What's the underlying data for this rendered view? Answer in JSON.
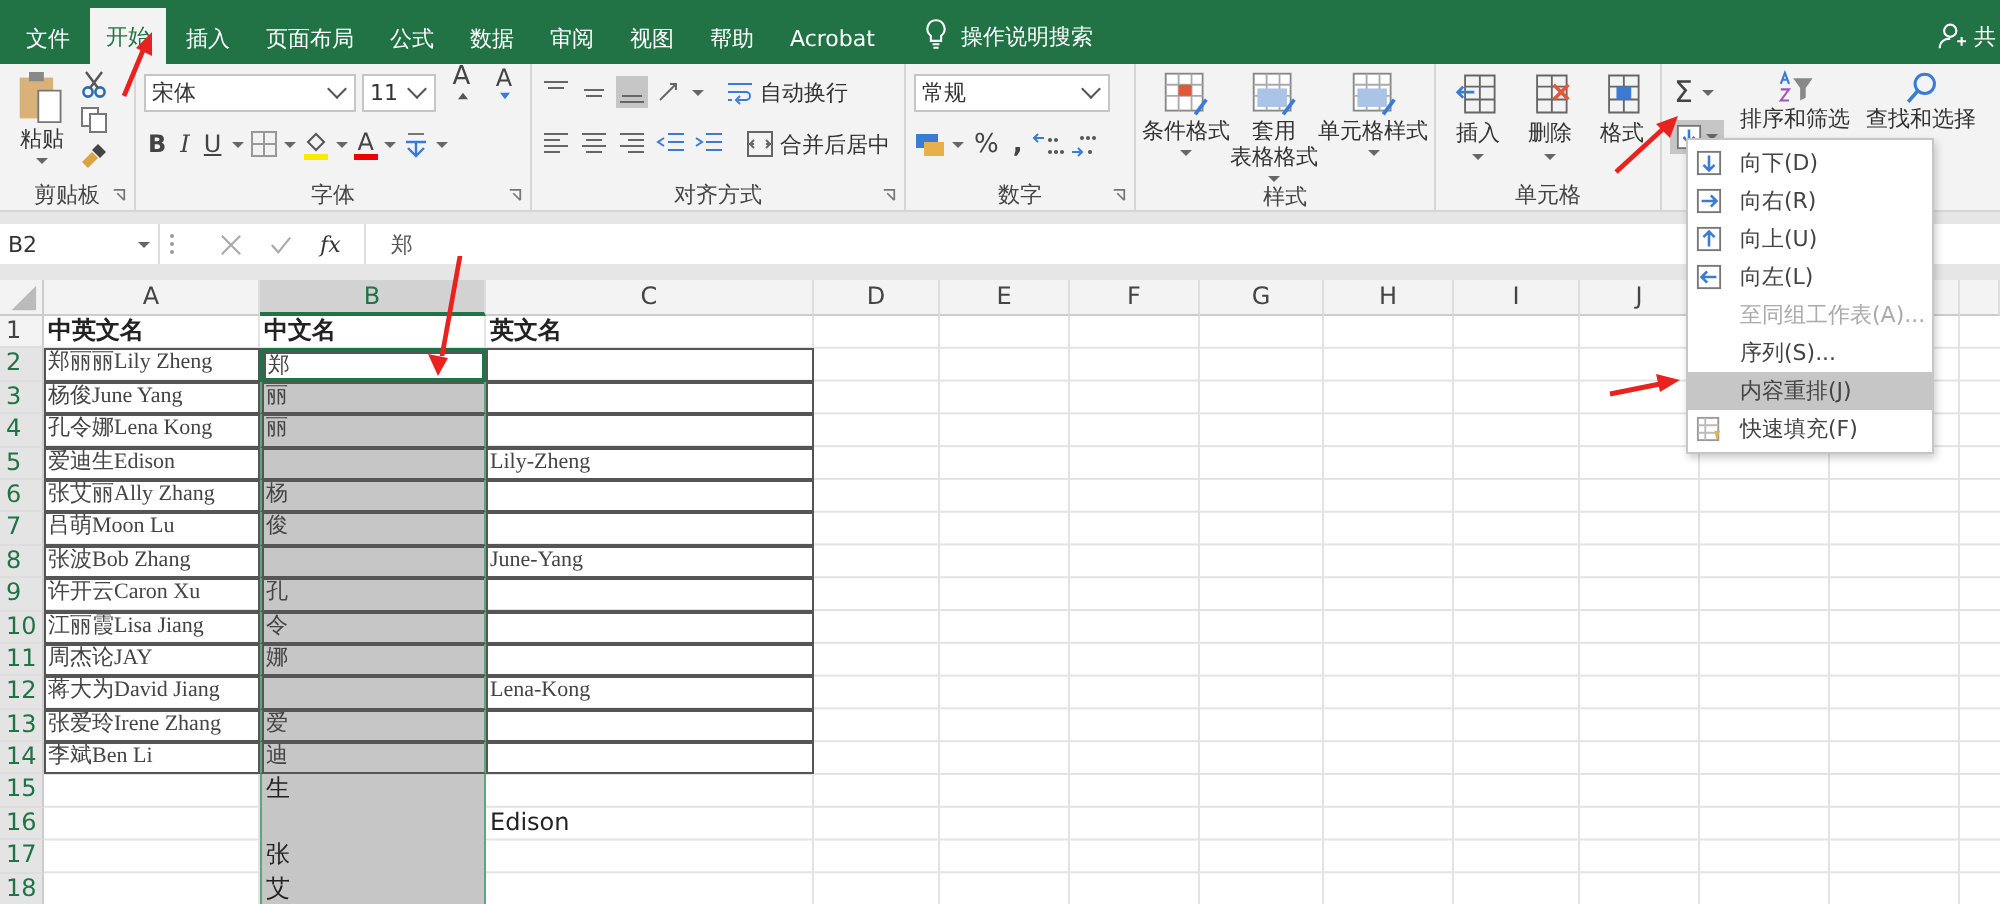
{
  "tabs": [
    {
      "label": "文件",
      "selected": false
    },
    {
      "label": "开始",
      "selected": true
    },
    {
      "label": "插入",
      "selected": false
    },
    {
      "label": "页面布局",
      "selected": false
    },
    {
      "label": "公式",
      "selected": false
    },
    {
      "label": "数据",
      "selected": false
    },
    {
      "label": "审阅",
      "selected": false
    },
    {
      "label": "视图",
      "selected": false
    },
    {
      "label": "帮助",
      "selected": false
    },
    {
      "label": "Acrobat",
      "selected": false
    }
  ],
  "tell_me": "操作说明搜索",
  "share": "共",
  "ribbon": {
    "clipboard": {
      "paste": "粘贴",
      "label": "剪贴板"
    },
    "font": {
      "name": "宋体",
      "size": "11",
      "grow": "A",
      "shrink": "A",
      "bold": "B",
      "italic": "I",
      "underline": "U",
      "color_button": "A",
      "label": "字体"
    },
    "alignment": {
      "wrap": "自动换行",
      "merge": "合并后居中",
      "label": "对齐方式"
    },
    "number": {
      "format": "常规",
      "percent": "%",
      "comma": ",",
      "label": "数字"
    },
    "styles": {
      "buttons": [
        {
          "lines": [
            "条件格式"
          ]
        },
        {
          "lines": [
            "套用",
            "表格格式"
          ]
        },
        {
          "lines": [
            "单元格样式"
          ]
        }
      ],
      "label": "样式"
    },
    "cells": {
      "buttons": [
        "插入",
        "删除",
        "格式"
      ],
      "label": "单元格"
    },
    "editing": {
      "sum": "Σ",
      "fill_open": true,
      "sort": "排序和筛选",
      "find": "查找和选择"
    }
  },
  "formula_bar": {
    "name_box": "B2",
    "fx": "fx",
    "value": "郑"
  },
  "columns": [
    {
      "label": "A",
      "selected": false
    },
    {
      "label": "B",
      "selected": true
    },
    {
      "label": "C",
      "selected": false
    },
    {
      "label": "D",
      "selected": false
    },
    {
      "label": "E",
      "selected": false
    },
    {
      "label": "F",
      "selected": false
    },
    {
      "label": "G",
      "selected": false
    },
    {
      "label": "H",
      "selected": false
    },
    {
      "label": "I",
      "selected": false
    },
    {
      "label": "J",
      "selected": false
    }
  ],
  "rows": [
    {
      "number": "1",
      "kind": "header",
      "selected": false,
      "active": false,
      "cells": {
        "A": "中英文名",
        "B": "中文名",
        "C": "英文名"
      }
    },
    {
      "number": "2",
      "kind": "table",
      "selected": true,
      "active": true,
      "cells": {
        "A": "郑丽丽Lily Zheng",
        "B": "郑"
      }
    },
    {
      "number": "3",
      "kind": "table",
      "selected": true,
      "active": false,
      "cells": {
        "A": "杨俊June Yang",
        "B": "丽"
      }
    },
    {
      "number": "4",
      "kind": "table",
      "selected": true,
      "active": false,
      "cells": {
        "A": "孔令娜Lena Kong",
        "B": "丽"
      }
    },
    {
      "number": "5",
      "kind": "table",
      "selected": true,
      "active": false,
      "cells": {
        "A": "爱迪生Edison",
        "C": "Lily-Zheng"
      }
    },
    {
      "number": "6",
      "kind": "table",
      "selected": true,
      "active": false,
      "cells": {
        "A": "张艾丽Ally Zhang",
        "B": "杨"
      }
    },
    {
      "number": "7",
      "kind": "table",
      "selected": true,
      "active": false,
      "cells": {
        "A": "吕萌Moon Lu",
        "B": "俊"
      }
    },
    {
      "number": "8",
      "kind": "table",
      "selected": true,
      "active": false,
      "cells": {
        "A": "张波Bob Zhang",
        "C": "June-Yang"
      }
    },
    {
      "number": "9",
      "kind": "table",
      "selected": true,
      "active": false,
      "cells": {
        "A": "许开云Caron Xu",
        "B": "孔"
      }
    },
    {
      "number": "10",
      "kind": "table",
      "selected": true,
      "active": false,
      "cells": {
        "A": "江丽霞Lisa Jiang",
        "B": "令"
      }
    },
    {
      "number": "11",
      "kind": "table",
      "selected": true,
      "active": false,
      "cells": {
        "A": "周杰论JAY",
        "B": "娜"
      }
    },
    {
      "number": "12",
      "kind": "table",
      "selected": true,
      "active": false,
      "cells": {
        "A": "蒋大为David Jiang",
        "C": "Lena-Kong"
      }
    },
    {
      "number": "13",
      "kind": "table",
      "selected": true,
      "active": false,
      "cells": {
        "A": "张爱玲Irene Zhang",
        "B": "爱"
      }
    },
    {
      "number": "14",
      "kind": "table",
      "selected": true,
      "active": false,
      "cells": {
        "A": "李斌Ben Li",
        "B": "迪"
      }
    },
    {
      "number": "15",
      "kind": "plain",
      "selected": true,
      "active": false,
      "cells": {
        "B": "生"
      }
    },
    {
      "number": "16",
      "kind": "plain",
      "selected": true,
      "active": false,
      "cells": {
        "C": "Edison"
      }
    },
    {
      "number": "17",
      "kind": "plain",
      "selected": true,
      "active": false,
      "cells": {
        "B": "张"
      }
    },
    {
      "number": "18",
      "kind": "plain",
      "selected": true,
      "active": false,
      "cells": {
        "B": "艾"
      }
    }
  ],
  "fill_menu": {
    "items": [
      {
        "label": "向下(D)",
        "kind": "down",
        "selected": false,
        "disabled": false
      },
      {
        "label": "向右(R)",
        "kind": "right",
        "selected": false,
        "disabled": false
      },
      {
        "label": "向上(U)",
        "kind": "up",
        "selected": false,
        "disabled": false
      },
      {
        "label": "向左(L)",
        "kind": "left",
        "selected": false,
        "disabled": false
      },
      {
        "label": "至同组工作表(A)...",
        "kind": "plain",
        "selected": false,
        "disabled": true
      },
      {
        "label": "序列(S)...",
        "kind": "plain",
        "selected": false,
        "disabled": false
      },
      {
        "label": "内容重排(J)",
        "kind": "plain",
        "selected": true,
        "disabled": false
      },
      {
        "label": "快速填充(F)",
        "kind": "flash",
        "selected": false,
        "disabled": false
      }
    ]
  }
}
